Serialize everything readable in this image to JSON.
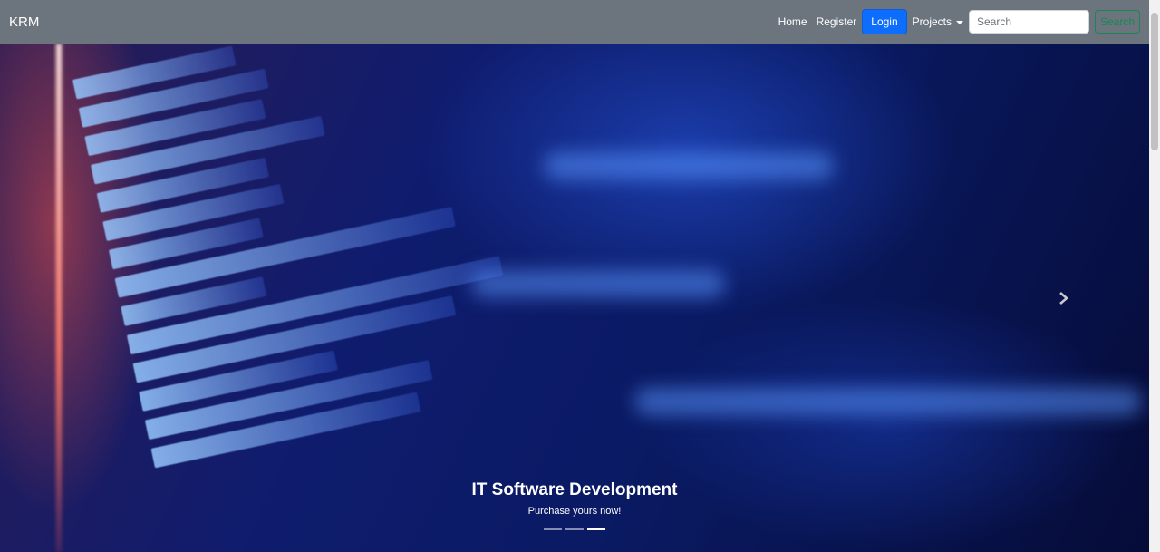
{
  "navbar": {
    "brand": "KRM",
    "links": {
      "home": "Home",
      "register": "Register"
    },
    "login_label": "Login",
    "projects_label": "Projects",
    "search": {
      "placeholder": "Search",
      "value": ""
    },
    "search_button": "Search"
  },
  "carousel": {
    "caption_title": "IT Software Development",
    "caption_subtitle": "Purchase yours now!",
    "slide_count": 3,
    "active_index": 2
  },
  "colors": {
    "navbar": "#6c757d",
    "login": "#0d6efd",
    "search_button": "#198754"
  },
  "icons": {
    "next": "chevron-right-icon",
    "dropdown": "caret-down-icon"
  }
}
